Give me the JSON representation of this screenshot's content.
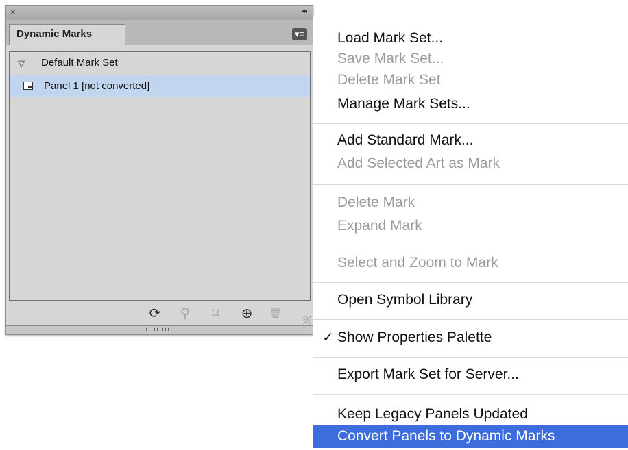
{
  "panel": {
    "close_glyph": "×",
    "collapse_glyph": "◂◂",
    "tab_label": "Dynamic Marks",
    "menu_button_glyph": "▾≡",
    "tree": {
      "group_label": "Default Mark Set",
      "group_triangle": "▽",
      "selected_item_label": "Panel 1 [not converted]"
    },
    "footer_icons": [
      {
        "name": "refresh-icon",
        "glyph": "⟳",
        "enabled": true
      },
      {
        "name": "zoom-icon",
        "glyph": "⚲",
        "enabled": false
      },
      {
        "name": "new-mark-from-art-icon",
        "glyph": "⌑",
        "enabled": false
      },
      {
        "name": "add-mark-icon",
        "glyph": "⊕",
        "enabled": true
      },
      {
        "name": "trash-icon",
        "glyph": "🗑",
        "enabled": false
      }
    ]
  },
  "menu": {
    "items": [
      {
        "label": "Load Mark Set...",
        "enabled": true
      },
      {
        "label": "Save Mark Set...",
        "enabled": false
      },
      {
        "label": "Delete Mark Set",
        "enabled": false
      },
      {
        "label": "Manage Mark Sets...",
        "enabled": true
      },
      {
        "label": "Add Standard Mark...",
        "enabled": true
      },
      {
        "label": "Add Selected Art as Mark",
        "enabled": false
      },
      {
        "label": "Delete Mark",
        "enabled": false
      },
      {
        "label": "Expand Mark",
        "enabled": false
      },
      {
        "label": "Select and Zoom to Mark",
        "enabled": false
      },
      {
        "label": "Open Symbol Library",
        "enabled": true
      },
      {
        "label": "Show Properties Palette",
        "enabled": true,
        "checked": true,
        "check_glyph": "✓"
      },
      {
        "label": "Export Mark Set for Server...",
        "enabled": true
      },
      {
        "label": "Keep Legacy Panels Updated",
        "enabled": true
      },
      {
        "label": "Convert Panels to Dynamic Marks",
        "enabled": true,
        "highlighted": true
      }
    ],
    "highlight_color": "#3d6ddc",
    "disabled_color": "#9b9b9b"
  }
}
